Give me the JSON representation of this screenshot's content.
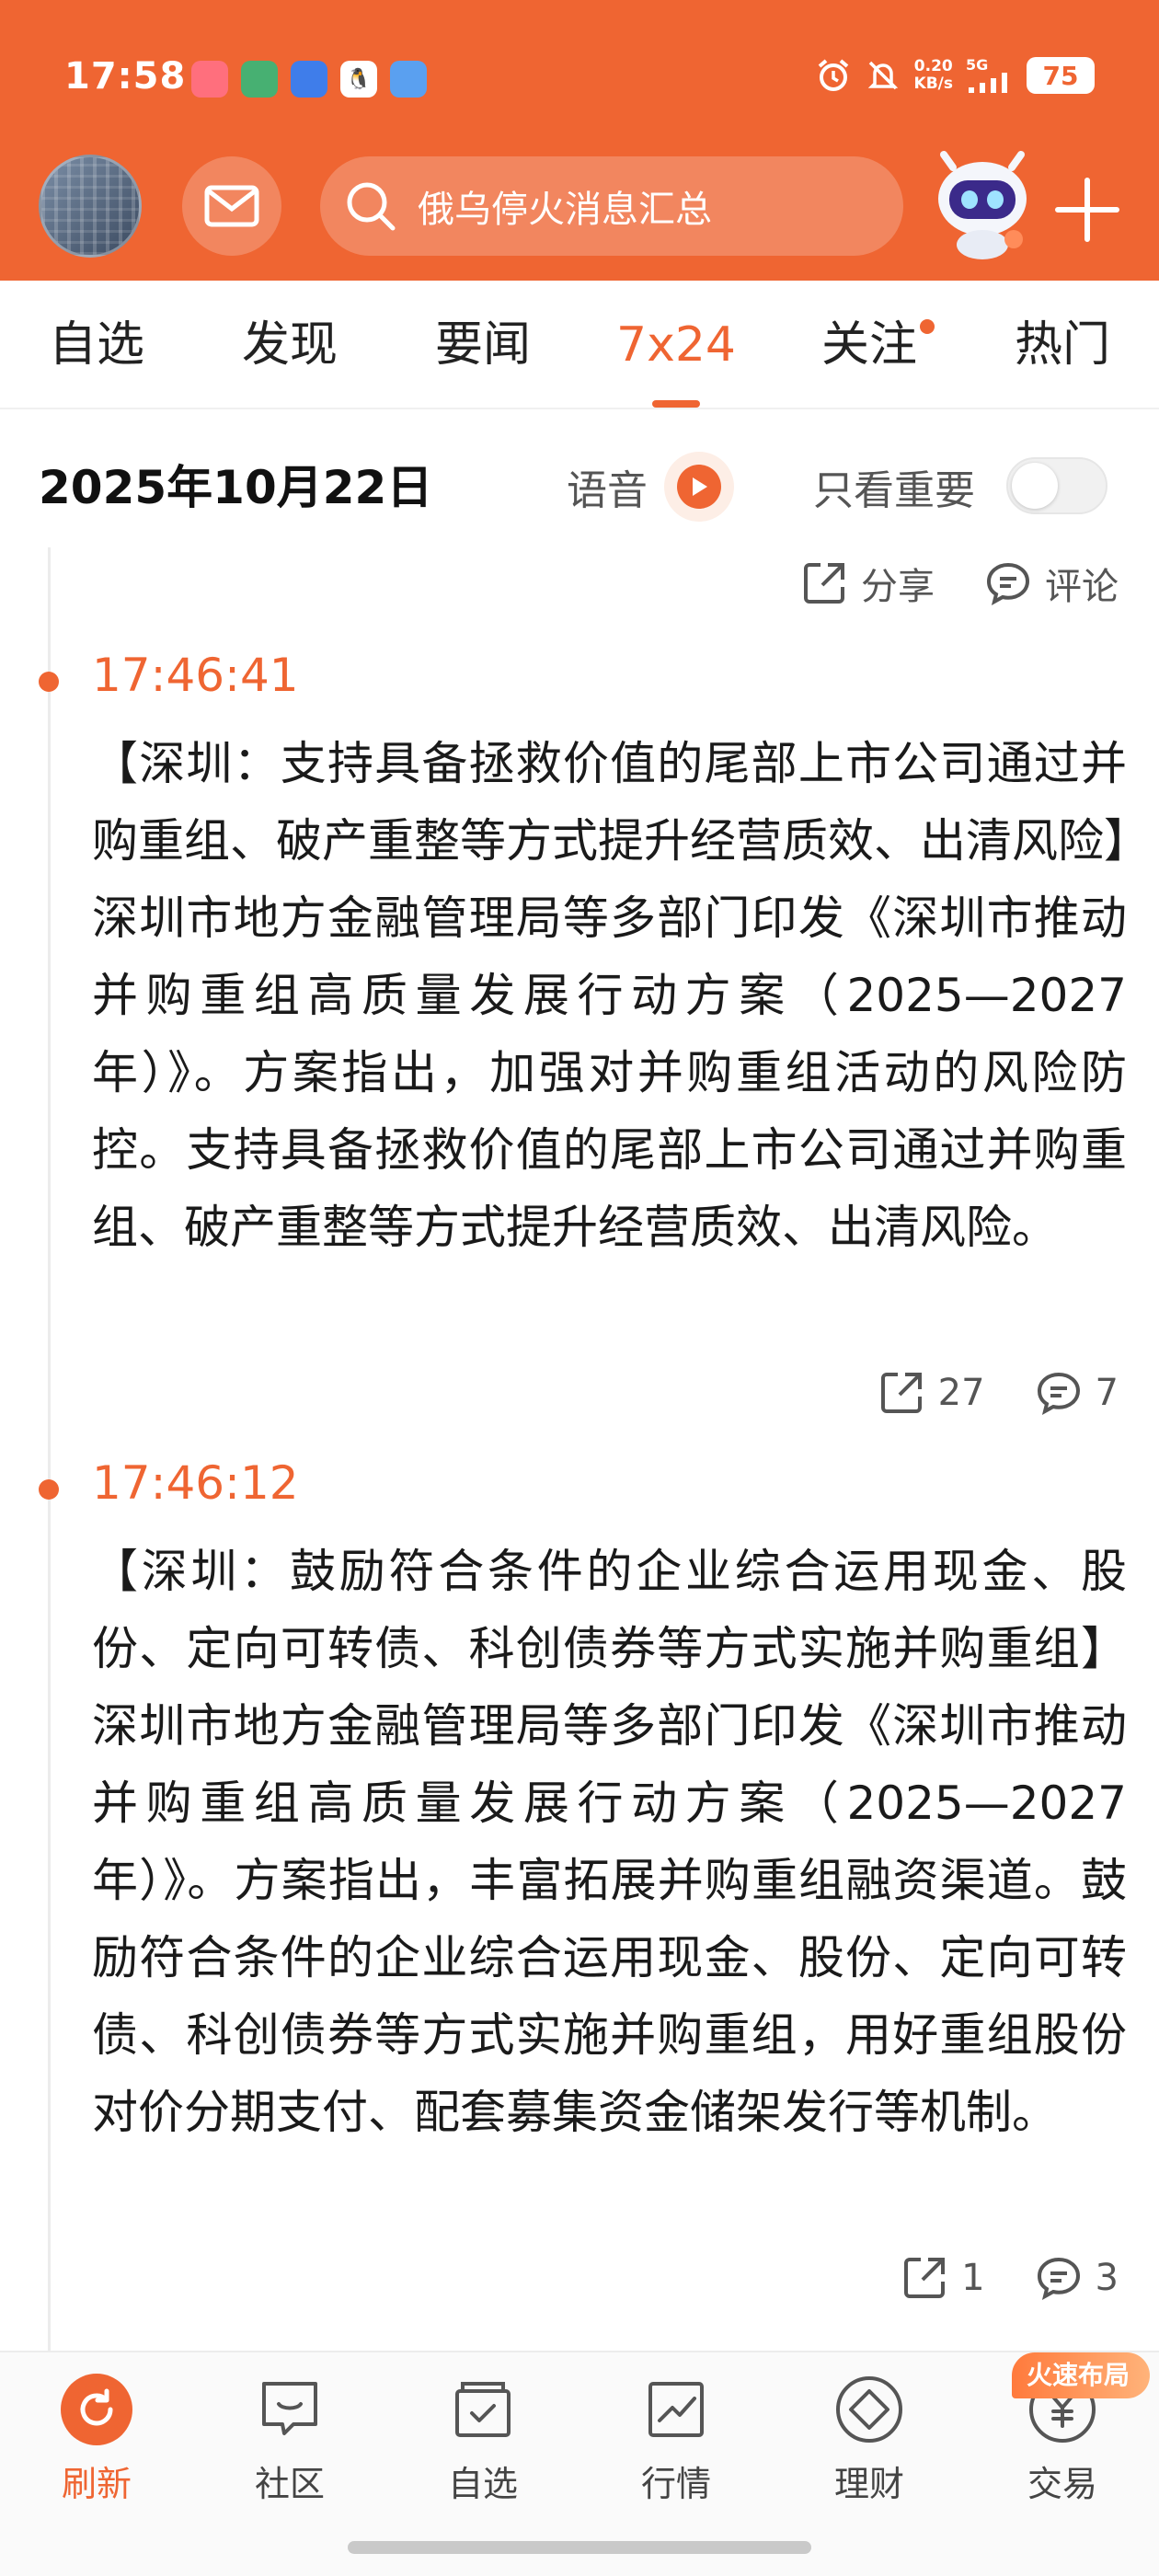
{
  "status": {
    "time": "17:58",
    "net_speed_value": "0.20",
    "net_speed_unit": "KB/s",
    "network": "5G",
    "battery": "75"
  },
  "header": {
    "search_placeholder": "俄乌停火消息汇总",
    "accent_color": "#ef6532"
  },
  "tabs": [
    {
      "label": "自选"
    },
    {
      "label": "发现"
    },
    {
      "label": "要闻"
    },
    {
      "label": "7x24"
    },
    {
      "label": "关注"
    },
    {
      "label": "热门"
    }
  ],
  "active_tab": "7x24",
  "date_row": {
    "date": "2025年10月22日",
    "voice_label": "语音",
    "important_only_label": "只看重要",
    "important_only": false
  },
  "top_actions": {
    "share_label": "分享",
    "comment_label": "评论"
  },
  "news": [
    {
      "time": "17:46:41",
      "body": "【深圳：支持具备拯救价值的尾部上市公司通过并购重组、破产重整等方式提升经营质效、出清风险】深圳市地方金融管理局等多部门印发《深圳市推动并购重组高质量发展行动方案（2025—2027年）》。方案指出，加强对并购重组活动的风险防控。支持具备拯救价值的尾部上市公司通过并购重组、破产重整等方式提升经营质效、出清风险。",
      "shares": "27",
      "comments": "7"
    },
    {
      "time": "17:46:12",
      "body": "【深圳：鼓励符合条件的企业综合运用现金、股份、定向可转债、科创债券等方式实施并购重组】深圳市地方金融管理局等多部门印发《深圳市推动并购重组高质量发展行动方案（2025—2027年）》。方案指出，丰富拓展并购重组融资渠道。鼓励符合条件的企业综合运用现金、股份、定向可转债、科创债券等方式实施并购重组，用好重组股份对价分期支付、配套募集资金储架发行等机制。",
      "shares": "1",
      "comments": "3"
    }
  ],
  "bottom_nav": [
    {
      "label": "刷新",
      "icon": "refresh-icon"
    },
    {
      "label": "社区",
      "icon": "chat-bubble-icon"
    },
    {
      "label": "自选",
      "icon": "checkbox-bag-icon"
    },
    {
      "label": "行情",
      "icon": "chart-icon"
    },
    {
      "label": "理财",
      "icon": "diamond-icon"
    },
    {
      "label": "交易",
      "icon": "yuan-icon"
    }
  ],
  "fast_badge": "火速布局"
}
